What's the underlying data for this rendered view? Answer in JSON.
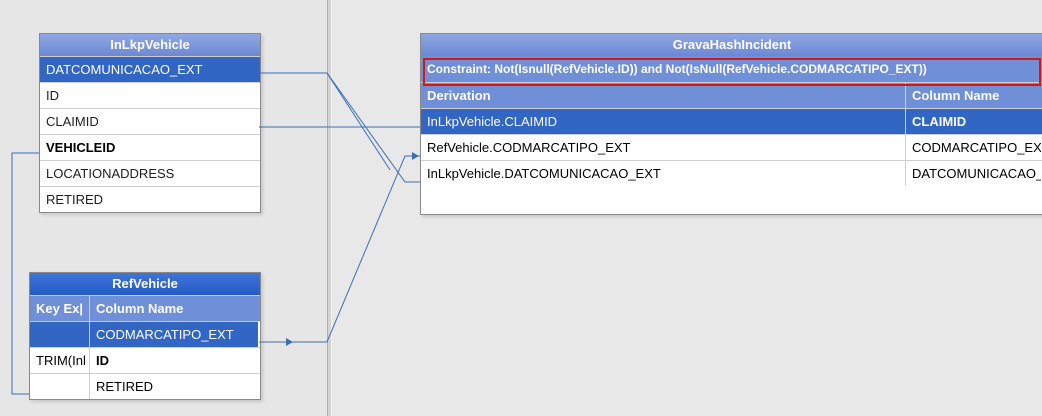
{
  "inlkp": {
    "title": "InLkpVehicle",
    "rows": [
      "DATCOMUNICACAO_EXT",
      "ID",
      "CLAIMID",
      "VEHICLEID",
      "LOCATIONADDRESS",
      "RETIRED"
    ]
  },
  "refvehicle": {
    "title": "RefVehicle",
    "headers": {
      "key": "Key Ex|",
      "column": "Column Name"
    },
    "rows": [
      {
        "key": "",
        "column": "CODMARCATIPO_EXT"
      },
      {
        "key": "TRIM(Inl",
        "column": "ID"
      },
      {
        "key": "",
        "column": "RETIRED"
      }
    ]
  },
  "grava": {
    "title": "GravaHashIncident",
    "constraint": "Constraint: Not(Isnull(RefVehicle.ID)) and Not(IsNull(RefVehicle.CODMARCATIPO_EXT))",
    "headers": {
      "derivation": "Derivation",
      "column": "Column Name"
    },
    "rows": [
      {
        "derivation": "InLkpVehicle.CLAIMID",
        "column": "CLAIMID"
      },
      {
        "derivation": "RefVehicle.CODMARCATIPO_EXT",
        "column": "CODMARCATIPO_EXT"
      },
      {
        "derivation": "InLkpVehicle.DATCOMUNICACAO_EXT",
        "column": "DATCOMUNICACAO_"
      }
    ]
  },
  "colors": {
    "selection": "#3266c5",
    "header": "#6f8fd9",
    "title_dark": "#235bc6",
    "constraint_highlight": "#d01818",
    "link_line": "#3a6fb8"
  }
}
